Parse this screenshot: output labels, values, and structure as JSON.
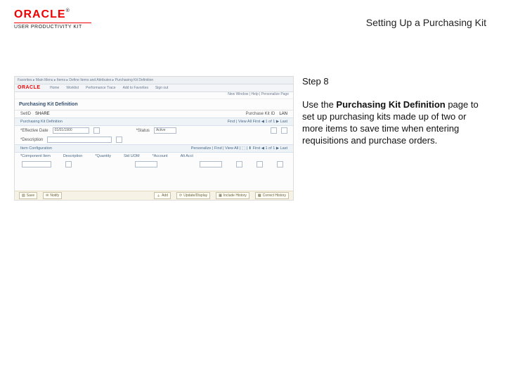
{
  "logo": {
    "brand": "ORACLE",
    "tm": "®",
    "subtitle": "USER PRODUCTIVITY KIT"
  },
  "doc_title": "Setting Up a Purchasing Kit",
  "side": {
    "step": "Step 8",
    "body_pre": "Use the ",
    "body_bold": "Purchasing Kit Definition",
    "body_post": " page to set up purchasing kits made up of two or more items to save time when entering requisitions and purchase orders."
  },
  "shot": {
    "crumbs": "Favorites ▸ Main Menu ▸ Items ▸ Define Items and Attributes ▸ Purchasing Kit Definition",
    "tabs": [
      "Home",
      "Worklist",
      "Performance Trace",
      "Add to Favorites",
      "Sign out"
    ],
    "brand": "ORACLE",
    "userline": "New Window | Help | Personalize Page",
    "page_title": "Purchasing Kit Definition",
    "setid_lbl": "SetID",
    "setid_val": "SHARE",
    "kitid_lbl": "Purchase Kit ID",
    "kitid_val": "LAN",
    "section1": "Purchasing Kit Definition",
    "nav1": "Find | View All   First ◀ 1 of 1 ▶ Last",
    "eff_lbl": "*Effective Date",
    "eff_val": "01/01/1900",
    "status_lbl": "*Status",
    "status_val": "Active",
    "desc_lbl": "*Description",
    "section2": "Item Configuration",
    "nav2": "Personalize | Find | View All | ⬚ | ⬇   First ◀ 1 of 1 ▶ Last",
    "grid": {
      "c1": "*Component Item",
      "c2": "Description",
      "c3": "*Quantity",
      "c4": "Std UOM",
      "c5": "*Account",
      "c6": "Alt Acct"
    },
    "footer": {
      "save": "Save",
      "notify": "Notify",
      "add": "Add",
      "updisp": "Update/Display",
      "inclhist": "Include History",
      "correct": "Correct History"
    }
  }
}
